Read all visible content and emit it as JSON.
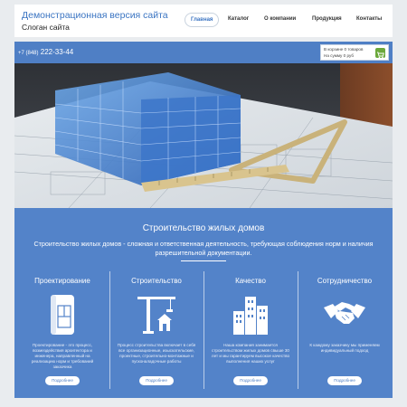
{
  "site": {
    "title": "Демонстрационная версия сайта",
    "slogan": "Слоган сайта"
  },
  "nav": {
    "items": [
      {
        "label": "Главная",
        "active": true
      },
      {
        "label": "Каталог",
        "active": false
      },
      {
        "label": "О компании",
        "active": false
      },
      {
        "label": "Продукция",
        "active": false
      },
      {
        "label": "Контакты",
        "active": false
      }
    ]
  },
  "topbar": {
    "phone_prefix": "+7 (848)",
    "phone_number": "222-33-44",
    "cart_line1": "В корзине 0 товаров",
    "cart_line2": "На сумму 0 руб",
    "cart_icon": "cart-icon"
  },
  "hero": {
    "image": "building-blueprint-photo"
  },
  "section": {
    "title": "Строительство жилых домов",
    "description": "Строительство жилых домов - сложная и ответственная деятельность, требующая соблюдения норм и наличия разрешительной документации."
  },
  "cards": [
    {
      "title": "Проектирование",
      "icon": "blueprint-icon",
      "text": "Проектирование - это процесс, возмездействия архитектора и инженера, направленный на реализацию норм и требований заказчика",
      "button": "Подробнее"
    },
    {
      "title": "Строительство",
      "icon": "crane-icon",
      "text": "Процесс строительства включает в себя все организационные, изыскательские, проектные, строительно-монтажные и пусконаладочные работы",
      "button": "Подробнее"
    },
    {
      "title": "Качество",
      "icon": "buildings-icon",
      "text": "Наша компания занимается строительством жилых домов свыше 30 лет и мы гарантируем высокое качество выполнения наших услуг",
      "button": "Подробнее"
    },
    {
      "title": "Сотрудничество",
      "icon": "handshake-icon",
      "text": "К каждому заказчику мы применяем индивидуальный подход",
      "button": "Подробнее"
    }
  ],
  "colors": {
    "accent": "#3a74c2",
    "section_bg": "#5383c9",
    "cart_green": "#6ba83b"
  }
}
